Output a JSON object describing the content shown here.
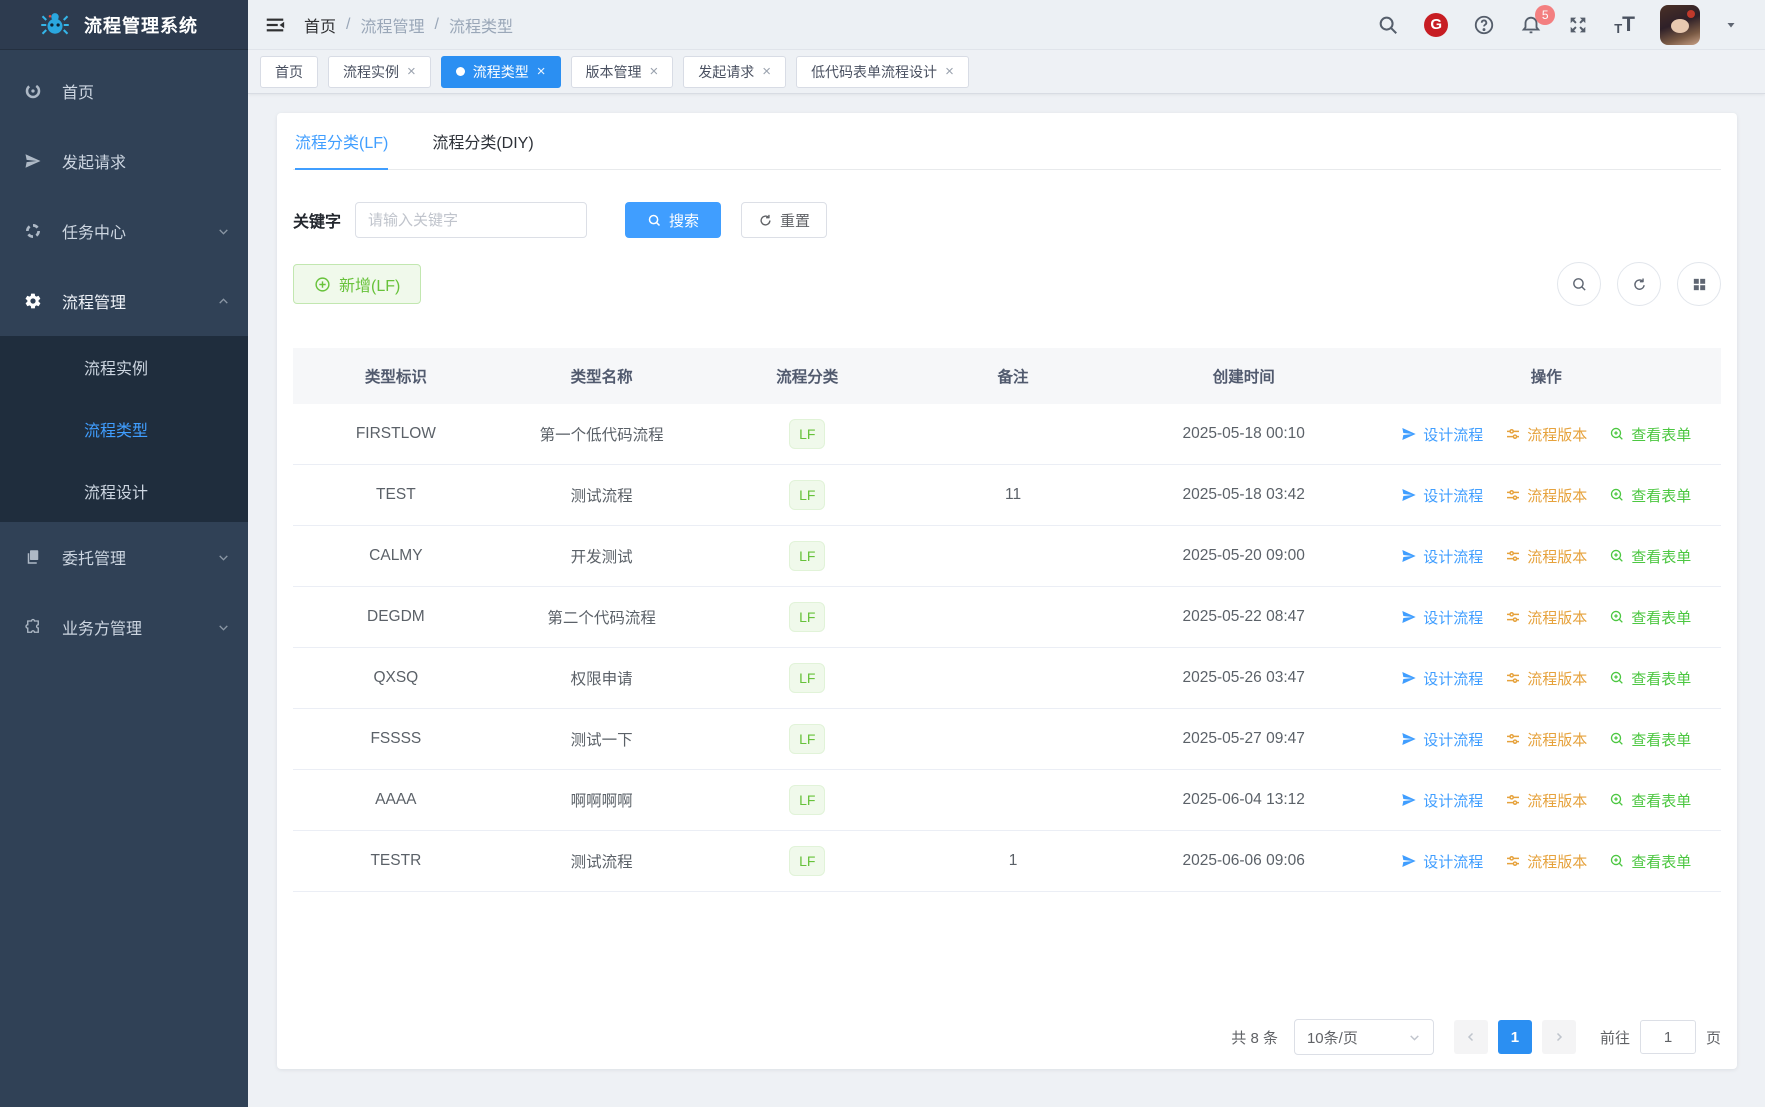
{
  "app": {
    "title": "流程管理系统"
  },
  "sidebar": {
    "items": [
      {
        "label": "首页"
      },
      {
        "label": "发起请求"
      },
      {
        "label": "任务中心"
      },
      {
        "label": "流程管理",
        "children": [
          {
            "label": "流程实例",
            "active": false
          },
          {
            "label": "流程类型",
            "active": true
          },
          {
            "label": "流程设计",
            "active": false
          }
        ]
      },
      {
        "label": "委托管理"
      },
      {
        "label": "业务方管理"
      }
    ]
  },
  "header": {
    "breadcrumb": [
      "首页",
      "流程管理",
      "流程类型"
    ],
    "breadcrumb_separator": "/",
    "notification_count": "5",
    "gitee_letter": "G",
    "help_mark": "?",
    "font_icon_small": "T",
    "font_icon_large": "T"
  },
  "tabs": {
    "close_glyph": "×",
    "items": [
      {
        "label": "首页",
        "closable": false,
        "active": false
      },
      {
        "label": "流程实例",
        "closable": true,
        "active": false
      },
      {
        "label": "流程类型",
        "closable": true,
        "active": true
      },
      {
        "label": "版本管理",
        "closable": true,
        "active": false
      },
      {
        "label": "发起请求",
        "closable": true,
        "active": false
      },
      {
        "label": "低代码表单流程设计",
        "closable": true,
        "active": false
      }
    ]
  },
  "page": {
    "subtabs": [
      {
        "label": "流程分类(LF)",
        "active": true
      },
      {
        "label": "流程分类(DIY)",
        "active": false
      }
    ],
    "filter": {
      "keyword_label": "关键字",
      "keyword_placeholder": "请输入关键字",
      "keyword_value": "",
      "search_label": "搜索",
      "reset_label": "重置"
    },
    "toolbar": {
      "add_label": "新增(LF)"
    },
    "table": {
      "headers": [
        "类型标识",
        "类型名称",
        "流程分类",
        "备注",
        "创建时间",
        "操作"
      ],
      "actions": [
        {
          "label": "设计流程",
          "color": "#409eff"
        },
        {
          "label": "流程版本",
          "color": "#e6a23c"
        },
        {
          "label": "查看表单",
          "color": "#67c23a"
        }
      ],
      "rows": [
        {
          "code": "FIRSTLOW",
          "name": "第一个低代码流程",
          "category": "LF",
          "remark": "",
          "created": "2025-05-18 00:10"
        },
        {
          "code": "TEST",
          "name": "测试流程",
          "category": "LF",
          "remark": "11",
          "created": "2025-05-18 03:42"
        },
        {
          "code": "CALMY",
          "name": "开发测试",
          "category": "LF",
          "remark": "",
          "created": "2025-05-20 09:00"
        },
        {
          "code": "DEGDM",
          "name": "第二个代码流程",
          "category": "LF",
          "remark": "",
          "created": "2025-05-22 08:47"
        },
        {
          "code": "QXSQ",
          "name": "权限申请",
          "category": "LF",
          "remark": "",
          "created": "2025-05-26 03:47"
        },
        {
          "code": "FSSSS",
          "name": "测试一下",
          "category": "LF",
          "remark": "",
          "created": "2025-05-27 09:47"
        },
        {
          "code": "AAAA",
          "name": "啊啊啊啊",
          "category": "LF",
          "remark": "",
          "created": "2025-06-04 13:12"
        },
        {
          "code": "TESTR",
          "name": "测试流程",
          "category": "LF",
          "remark": "1",
          "created": "2025-06-06 09:06"
        }
      ]
    },
    "pagination": {
      "total_text": "共 8 条",
      "page_size_text": "10条/页",
      "current_page": "1",
      "goto_label": "前往",
      "goto_value": "1",
      "page_unit": "页"
    }
  },
  "colors": {
    "primary": "#409eff",
    "tab_active": "#2b8ff2",
    "success": "#67c23a",
    "warning": "#e6a23c",
    "danger": "#f56c6c",
    "sidebar_bg": "#304156",
    "submenu_bg": "#1f2d3d",
    "gitee_red": "#c71d23"
  }
}
